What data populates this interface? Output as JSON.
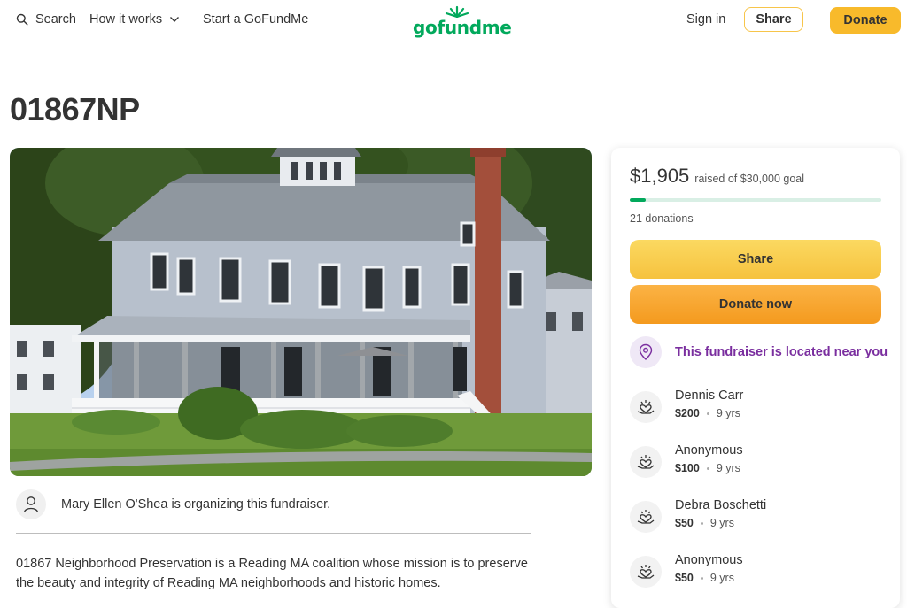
{
  "header": {
    "search_label": "Search",
    "how_label": "How it works",
    "start_label": "Start a GoFundMe",
    "logo_text": "gofundme",
    "signin_label": "Sign in",
    "share_label": "Share",
    "donate_label": "Donate"
  },
  "page_title": "01867NP",
  "organizer": {
    "text": "Mary Ellen O'Shea is organizing this fundraiser."
  },
  "description": "01867 Neighborhood Preservation is a Reading MA coalition whose mission is to preserve the beauty and integrity of Reading MA neighborhoods and historic homes.",
  "card": {
    "raised_amount": "$1,905",
    "raised_goal": "raised of $30,000 goal",
    "progress_fraction": 0.0635,
    "donations_count": "21 donations",
    "share_label": "Share",
    "donate_label": "Donate now",
    "near_text": "This fundraiser is located near you"
  },
  "donations": [
    {
      "name": "Dennis Carr",
      "amount": "$200",
      "time": "9 yrs"
    },
    {
      "name": "Anonymous",
      "amount": "$100",
      "time": "9 yrs"
    },
    {
      "name": "Debra Boschetti",
      "amount": "$50",
      "time": "9 yrs"
    },
    {
      "name": "Anonymous",
      "amount": "$50",
      "time": "9 yrs"
    }
  ],
  "colors": {
    "brand_green": "#02a95c",
    "button_yellow": "#f6c23e",
    "button_orange": "#f49a1e",
    "near_purple": "#7a2e9f"
  },
  "icons": [
    "search-icon",
    "chevron-down-icon",
    "user-icon",
    "location-pin-icon",
    "heart-hand-icon"
  ]
}
